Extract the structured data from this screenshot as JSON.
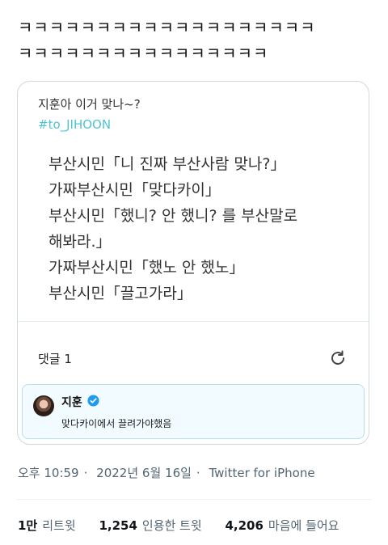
{
  "tweet": {
    "text_line1": "ㅋㅋㅋㅋㅋㅋㅋㅋㅋㅋㅋㅋㅋㅋㅋㅋㅋㅋㅋ",
    "text_line2": "ㅋㅋㅋㅋㅋㅋㅋㅋㅋㅋㅋㅋㅋㅋㅋㅋ"
  },
  "card": {
    "title": "지훈아 이거 맞나~?",
    "hashtag": "#to_JIHOON",
    "body_lines": [
      "부산시민「니 진짜 부산사람 맞나?」",
      "가짜부산시민「맞다카이」",
      "부산시민「했니? 안 했니? 를 부산말로",
      "해봐라.」",
      "가짜부산시민「했노 안 했노」",
      "부산시민「끌고가라」"
    ],
    "comment_count_label": "댓글 1",
    "comment": {
      "author": "지훈",
      "text": "맞다카이에서 끌려가야했음"
    }
  },
  "meta": {
    "time": "오후 10:59",
    "date": "2022년 6월 16일",
    "source": "Twitter for iPhone"
  },
  "stats": {
    "retweets_value": "1만",
    "retweets_label": "리트윗",
    "quotes_value": "1,254",
    "quotes_label": "인용한 트윗",
    "likes_value": "4,206",
    "likes_label": "마음에 들어요"
  },
  "colors": {
    "hashtag": "#4fc3d6",
    "verified": "#1d9bf0",
    "comment_border": "#b7dff0"
  },
  "icons": [
    "refresh-icon",
    "verified-icon"
  ]
}
